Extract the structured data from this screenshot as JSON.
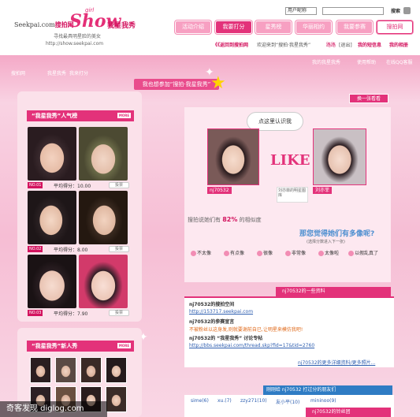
{
  "header": {
    "site": "Seekpai.com",
    "site_cn": "搜拍网",
    "logo_show": "Show",
    "logo_girl": "girl",
    "logo_cn": "我星我秀",
    "tagline": "寻找最具明星脸的美女",
    "url": "http://show.seekpai.com",
    "select_value": "用户昵称",
    "search_label": "搜索"
  },
  "nav": [
    {
      "label": "活动介绍"
    },
    {
      "label": "我要打分"
    },
    {
      "label": "星秀榜"
    },
    {
      "label": "华丽相约"
    },
    {
      "label": "我要参赛"
    },
    {
      "label": "搜拍网"
    }
  ],
  "subnav": {
    "back": "《《返回到搜拍网",
    "welcome": "欢迎来到“搜拍·我星我秀”",
    "user": "路路",
    "logout": "[退出]",
    "my_tags": "我的短信息",
    "my_albums": "我的相册"
  },
  "userbar": {
    "my_show": "我的我星我秀",
    "help": "使用帮助",
    "qq": "在线QQ客服"
  },
  "breadcrumb": [
    "搜拍网",
    "我星我秀",
    "我来打分"
  ],
  "invite": "我也想参加“搜拍·我星我秀”",
  "change_button": "换一张看看",
  "left": {
    "title": "“我星我秀”人气榜",
    "more": "MORE",
    "entries": [
      {
        "rank": "NO.01",
        "score": "平均得分：10.00",
        "vote": "投票"
      },
      {
        "rank": "NO.02",
        "score": "平均得分：8.00",
        "vote": "投票"
      },
      {
        "rank": "NO.03",
        "score": "平均得分：7.90",
        "vote": "投票"
      }
    ],
    "new_title": "“我星我秀”新人秀",
    "new_more": "MORE"
  },
  "compare": {
    "bubble": "点这里认识我",
    "like": "LIKE",
    "user_name": "nj70532",
    "star_name": "刘亦菲",
    "note": "刘亦菲的明星图库",
    "similarity_prefix": "搜拍说她们有",
    "similarity_value": "82%",
    "similarity_suffix": "的相似度",
    "question": "那您觉得她们有多像呢?",
    "question_sub": "(选择分数进入下一张)",
    "options": [
      "不太像",
      "有点像",
      "很像",
      "非常像",
      "太像啦",
      "以假乱真了"
    ]
  },
  "profile": {
    "title": "nj70532的一些资料",
    "space_title": "nj70532的搜拍空间",
    "space_url": "http://153717.seekpai.com",
    "declare_title": "nj70532的参赛宣言",
    "declare_text": "不被粉丝以这身发,则就要谢前自已,让明星来模仿我吧!",
    "thread_title": "nj70532的 “我星我秀” 讨论专帖",
    "thread_url": "http://bbs.seekpai.com/thread.skp?fid=17&tid=2760",
    "more_link": "nj70532的更多详细资料/更多照片..."
  },
  "friends": {
    "title": "刚刚给 nj70532 打过分的朋友们",
    "items": [
      "sime(6)",
      "xu.(7)",
      "zzy271(10)",
      "友小平(10)",
      "mininoo(9)"
    ]
  },
  "bottom_title": "nj70532的铃丝团",
  "watermark": "奇客发现 diglog.com",
  "colors": {
    "accent": "#e3327a",
    "pink_bg": "#f7c6da",
    "blue": "#2f7cc4"
  }
}
